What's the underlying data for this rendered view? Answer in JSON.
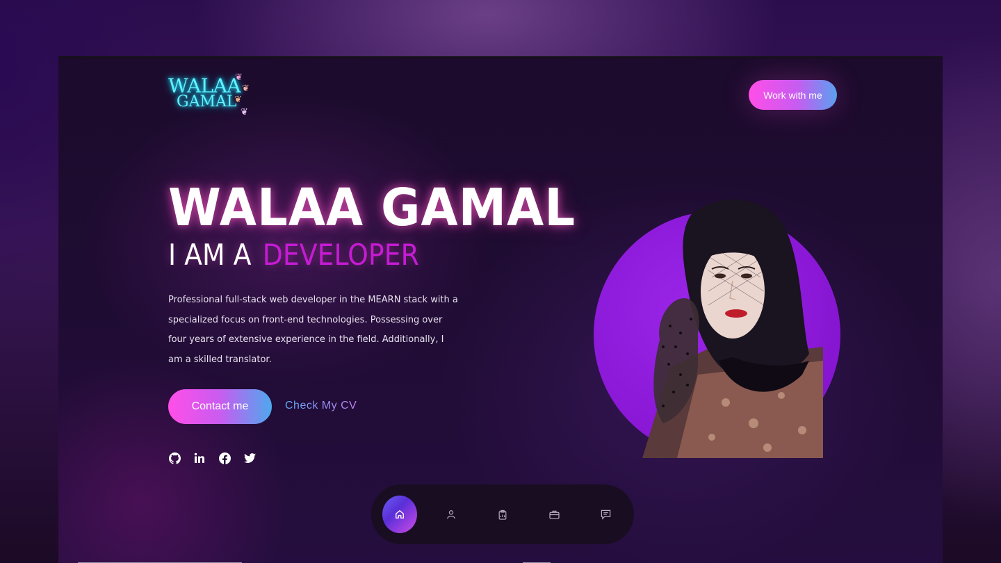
{
  "logo": {
    "line1": "WALAA",
    "line2": "GAMAL"
  },
  "header": {
    "cta_label": "Work with me"
  },
  "hero": {
    "name": "WALAA GAMAL",
    "role_prefix": "I AM A",
    "role_accent": "DEVELOPER",
    "description": "Professional full-stack web developer in the MEARN stack with a specialized focus on front-end technologies. Possessing over four years of extensive experience in the field. Additionally, I am a skilled translator.",
    "contact_label": "Contact me",
    "cv_label": "Check My CV"
  },
  "socials": [
    {
      "icon": "github-icon"
    },
    {
      "icon": "linkedin-icon"
    },
    {
      "icon": "facebook-icon"
    },
    {
      "icon": "twitter-icon"
    }
  ],
  "nav": [
    {
      "icon": "home-icon",
      "active": true
    },
    {
      "icon": "user-icon",
      "active": false
    },
    {
      "icon": "clipboard-icon",
      "active": false
    },
    {
      "icon": "briefcase-icon",
      "active": false
    },
    {
      "icon": "message-icon",
      "active": false
    }
  ],
  "colors": {
    "accent_pink": "#ff4ee8",
    "accent_purple": "#c61bd4",
    "accent_blue": "#4ea8ee",
    "logo_cyan": "#5ff4ff",
    "circle_purple": "#8a18d6"
  }
}
